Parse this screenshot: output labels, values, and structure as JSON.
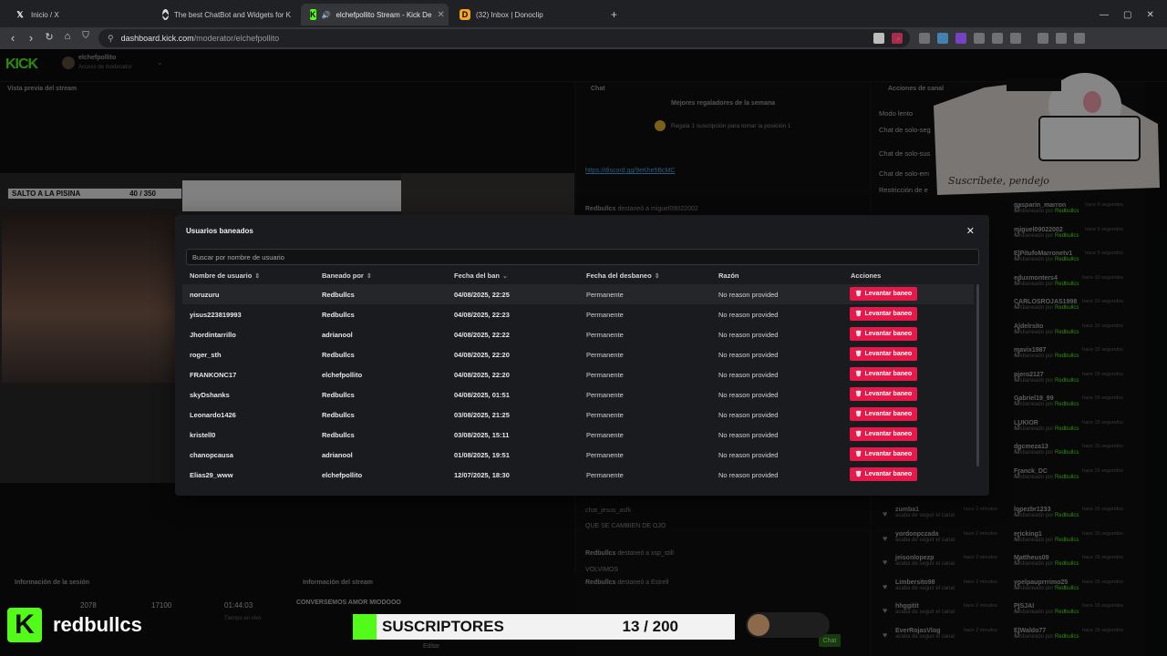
{
  "browser": {
    "tabs": [
      {
        "title": "Inicio / X",
        "icon": "x-logo-icon"
      },
      {
        "title": "The best ChatBot and Widgets for K",
        "icon": "botrix-icon"
      },
      {
        "title": "elchefpollito Stream - Kick De",
        "icon": "kick-icon"
      },
      {
        "title": "(32) Inbox | Donoclip",
        "icon": "donoclip-icon"
      }
    ],
    "url_host": "dashboard.kick.com",
    "url_path": "/moderator/elchefpollito"
  },
  "kick": {
    "logo": "KICK",
    "channel_name": "elchefpollito",
    "channel_sub": "Acceso de moderador",
    "preview_title": "Vista previa del stream",
    "chat_title": "Chat",
    "actions_title": "Acciones de canal",
    "top_gifters": "Mejores regaladores de la semana",
    "gift_prompt": "Regala 1 suscripción para tomar la posición 1",
    "discord_link": "https://discord.gg/9eKhe5BcMC",
    "session_title": "Información de la sesión",
    "stream_info_title": "Información del stream",
    "stream_name": "CONVERSEMOS AMOR MIODOOO",
    "session_stats": [
      "2078",
      "17100",
      "01:44:03"
    ],
    "session_stat_label": "Tiempo en vivo",
    "edit_label": "Editar",
    "chat_button": "Chat",
    "salto_label": "SALTO A LA PISINA",
    "salto_count": "40 / 350",
    "actions": [
      "Modo lento",
      "Chat de solo-seg",
      "Chat de solo-sus",
      "Chat de solo-em",
      "Restricción de e"
    ]
  },
  "chat_lines": [
    {
      "user": "Redbullcs",
      "text": "destaneó a miguel09022002"
    },
    {
      "user": "",
      "text": "chat_jesus_asfk"
    },
    {
      "user": "",
      "text": "QUE SE CAMBIEN DE OJO"
    },
    {
      "user": "",
      "text": "VOLVIMOS"
    },
    {
      "user": "Redbullcs",
      "text": "destaneó a xsp_still"
    },
    {
      "user": "Redbullcs",
      "text": "destaneó a Estrell"
    }
  ],
  "recent_bans": [
    {
      "name": "gasparin_marron",
      "ago": "hace 5 segundos"
    },
    {
      "name": "miguel09022002",
      "ago": "hace 5 segundos"
    },
    {
      "name": "ElPitufoMarronetv1",
      "ago": "hace 5 segundos"
    },
    {
      "name": "eduxmonters4",
      "ago": "hace 10 segundos"
    },
    {
      "name": "CARLOSROJAS1998",
      "ago": "hace 10 segundos"
    },
    {
      "name": "Aldelrsito",
      "ago": "hace 10 segundos"
    },
    {
      "name": "mavix1987",
      "ago": "hace 15 segundos"
    },
    {
      "name": "piero2127",
      "ago": "hace 15 segundos"
    },
    {
      "name": "Gabriel19_99",
      "ago": "hace 15 segundos"
    },
    {
      "name": "LUKIOR",
      "ago": "hace 15 segundos"
    },
    {
      "name": "dgcmeza13",
      "ago": "hace 15 segundos"
    },
    {
      "name": "Franck_DC",
      "ago": "hace 15 segundos"
    }
  ],
  "recent_follows": [
    {
      "name": "zumba1",
      "ago": "hace 2 minutos"
    },
    {
      "name": "yordonpczada",
      "ago": "hace 2 minutos"
    },
    {
      "name": "jeisonlopezp",
      "ago": "hace 2 minutos"
    },
    {
      "name": "Limbersito98",
      "ago": "hace 2 minutos"
    },
    {
      "name": "hhggitit",
      "ago": "hace 2 minutos"
    },
    {
      "name": "EverRojasVlog",
      "ago": "hace 2 minutos"
    }
  ],
  "recent_bans_2": [
    {
      "name": "lopezbr1233",
      "ago": "hace 15 segundos"
    },
    {
      "name": "ericking1",
      "ago": "hace 15 segundos"
    },
    {
      "name": "Mattheus09",
      "ago": "hace 15 segundos"
    },
    {
      "name": "yoelpauprrrimo25",
      "ago": "hace 15 segundos"
    },
    {
      "name": "PISJAI",
      "ago": "hace 15 segundos"
    },
    {
      "name": "ElWaldo77",
      "ago": "hace 15 segundos"
    }
  ],
  "recent_labels": {
    "by": "Redbullcs",
    "banned_prefix": "desbaneado por",
    "follow_text": "acaba de seguir el canal"
  },
  "modal": {
    "title": "Usuarios baneados",
    "search_placeholder": "Buscar por nombre de usuario",
    "columns": [
      "Nombre de usuario",
      "Baneado por",
      "Fecha del ban",
      "Fecha del desbaneo",
      "Razón",
      "Acciones"
    ],
    "unban_label": "Levantar baneo",
    "rows": [
      {
        "user": "noruzuru",
        "by": "Redbullcs",
        "date": "04/08/2025, 22:25",
        "unban_date": "Permanente",
        "reason": "No reason provided"
      },
      {
        "user": "yisus223819993",
        "by": "Redbullcs",
        "date": "04/08/2025, 22:23",
        "unban_date": "Permanente",
        "reason": "No reason provided"
      },
      {
        "user": "Jhordintarrillo",
        "by": "adrianool",
        "date": "04/08/2025, 22:22",
        "unban_date": "Permanente",
        "reason": "No reason provided"
      },
      {
        "user": "roger_sth",
        "by": "Redbullcs",
        "date": "04/08/2025, 22:20",
        "unban_date": "Permanente",
        "reason": "No reason provided"
      },
      {
        "user": "FRANKONC17",
        "by": "elchefpollito",
        "date": "04/08/2025, 22:20",
        "unban_date": "Permanente",
        "reason": "No reason provided"
      },
      {
        "user": "skyDshanks",
        "by": "Redbullcs",
        "date": "04/08/2025, 01:51",
        "unban_date": "Permanente",
        "reason": "No reason provided"
      },
      {
        "user": "Leonardo1426",
        "by": "Redbullcs",
        "date": "03/08/2025, 21:25",
        "unban_date": "Permanente",
        "reason": "No reason provided"
      },
      {
        "user": "kristell0",
        "by": "Redbullcs",
        "date": "03/08/2025, 15:11",
        "unban_date": "Permanente",
        "reason": "No reason provided"
      },
      {
        "user": "chanopcausa",
        "by": "adrianool",
        "date": "01/08/2025, 19:51",
        "unban_date": "Permanente",
        "reason": "No reason provided"
      },
      {
        "user": "Elias29_www",
        "by": "elchefpollito",
        "date": "12/07/2025, 18:30",
        "unban_date": "Permanente",
        "reason": "No reason provided"
      }
    ]
  },
  "overlay": {
    "brand_name": "redbullcs",
    "subs_label": "SUSCRIPTORES",
    "subs_count": "13 / 200",
    "sticker_text": "Suscríbete, pendejo"
  },
  "colors": {
    "kick_green": "#53fc18",
    "unban_red": "#e6194b",
    "modal_bg": "#1a1b1e"
  }
}
